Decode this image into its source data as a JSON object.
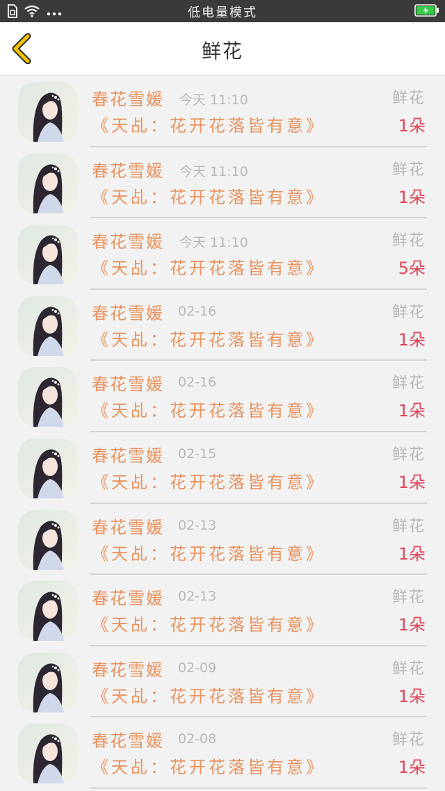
{
  "status_bar": {
    "title": "低电量模式",
    "icons": [
      "sim-icon",
      "wifi-icon",
      "more-dots-icon",
      "battery-charging-icon"
    ]
  },
  "header": {
    "title": "鲜花",
    "back_icon": "chevron-left-icon",
    "accent_color": "#f2c200"
  },
  "colors": {
    "name": "#e8935f",
    "count": "#e0455a",
    "muted": "#b8b8b8"
  },
  "gifts": [
    {
      "name": "春花雪媛",
      "time": "今天 11:10",
      "type": "鲜花",
      "book": "《天乩：花开花落皆有意》",
      "count": "1朵"
    },
    {
      "name": "春花雪媛",
      "time": "今天 11:10",
      "type": "鲜花",
      "book": "《天乩：花开花落皆有意》",
      "count": "1朵"
    },
    {
      "name": "春花雪媛",
      "time": "今天 11:10",
      "type": "鲜花",
      "book": "《天乩：花开花落皆有意》",
      "count": "5朵"
    },
    {
      "name": "春花雪媛",
      "time": "02-16",
      "type": "鲜花",
      "book": "《天乩：花开花落皆有意》",
      "count": "1朵"
    },
    {
      "name": "春花雪媛",
      "time": "02-16",
      "type": "鲜花",
      "book": "《天乩：花开花落皆有意》",
      "count": "1朵"
    },
    {
      "name": "春花雪媛",
      "time": "02-15",
      "type": "鲜花",
      "book": "《天乩：花开花落皆有意》",
      "count": "1朵"
    },
    {
      "name": "春花雪媛",
      "time": "02-13",
      "type": "鲜花",
      "book": "《天乩：花开花落皆有意》",
      "count": "1朵"
    },
    {
      "name": "春花雪媛",
      "time": "02-13",
      "type": "鲜花",
      "book": "《天乩：花开花落皆有意》",
      "count": "1朵"
    },
    {
      "name": "春花雪媛",
      "time": "02-09",
      "type": "鲜花",
      "book": "《天乩：花开花落皆有意》",
      "count": "1朵"
    },
    {
      "name": "春花雪媛",
      "time": "02-08",
      "type": "鲜花",
      "book": "《天乩：花开花落皆有意》",
      "count": "1朵"
    }
  ]
}
